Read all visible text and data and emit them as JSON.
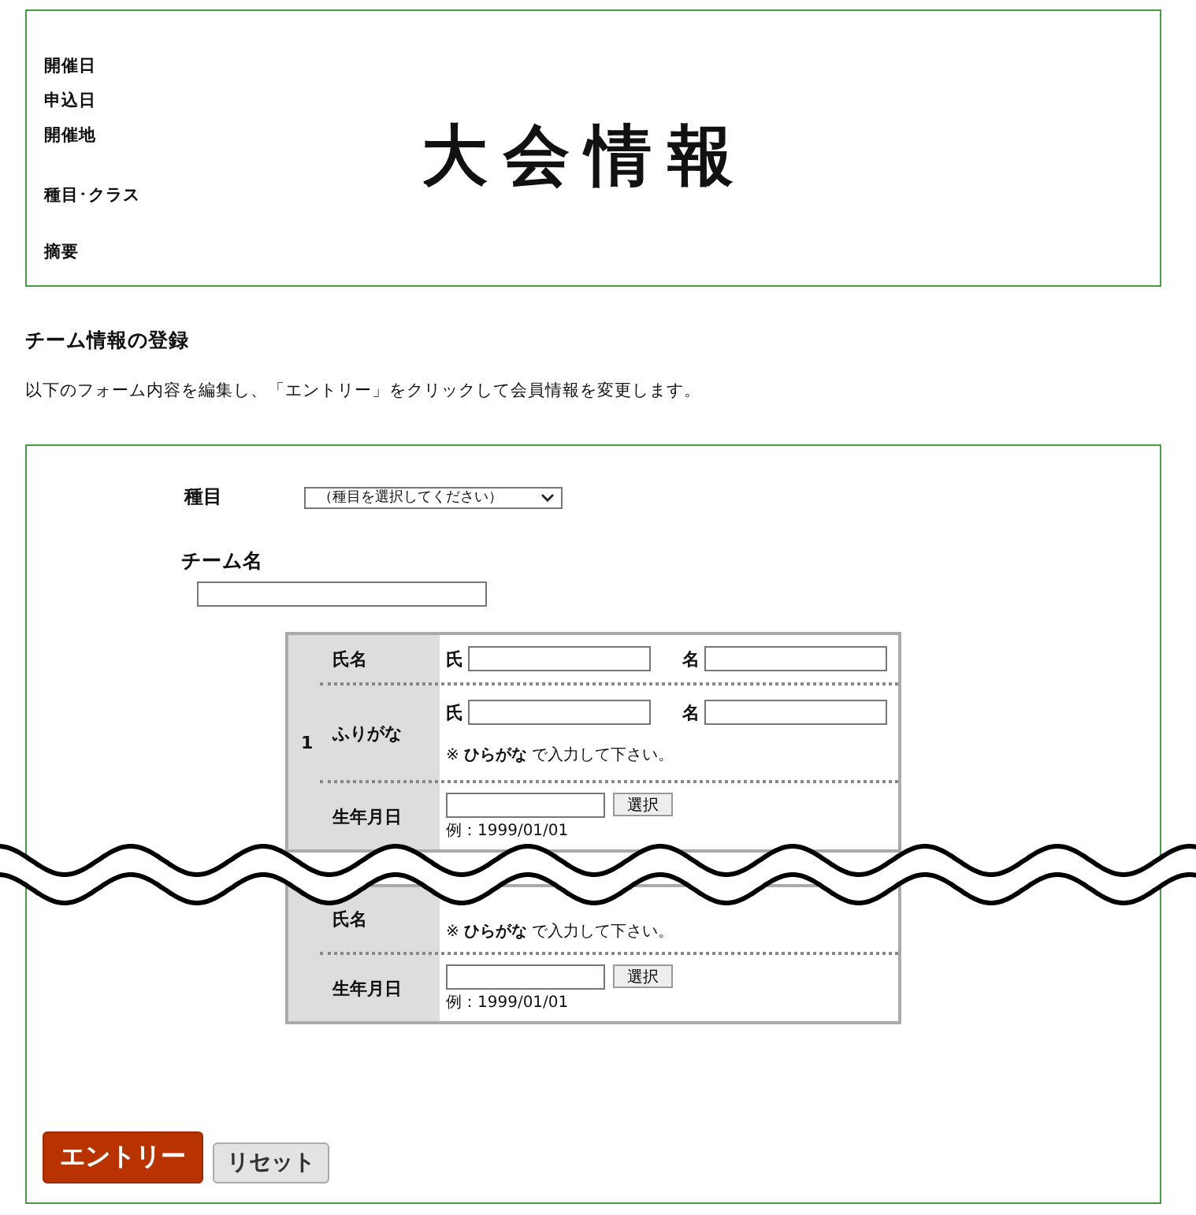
{
  "event_info": {
    "title": "大会情報",
    "fields": [
      {
        "label": "開催日"
      },
      {
        "label": "申込日"
      },
      {
        "label": "開催地"
      },
      {
        "label": "種目･クラス"
      },
      {
        "label": "摘要"
      }
    ]
  },
  "section": {
    "heading": "チーム情報の登録",
    "description": "以下のフォーム内容を編集し、「エントリー」をクリックして会員情報を変更します。"
  },
  "form": {
    "category": {
      "label": "種目",
      "value": "（種目を選択してください）"
    },
    "team_name": {
      "label": "チーム名"
    },
    "members": [
      {
        "number": "1",
        "rows": [
          {
            "kind": "name",
            "label": "氏名",
            "last_label": "氏",
            "first_label": "名"
          },
          {
            "kind": "kana",
            "label": "ふりがな",
            "last_label": "氏",
            "first_label": "名",
            "note": "※ **ひらがな** で入力して下さい。"
          },
          {
            "kind": "birth",
            "label": "生年月日",
            "button": "選択",
            "hint": "例：1999/01/01"
          }
        ]
      },
      {
        "rows": [
          {
            "kind": "partial",
            "label": "氏名",
            "note": "※ **ひらがな** で入力して下さい。"
          },
          {
            "kind": "birth",
            "label": "生年月日",
            "button": "選択",
            "hint": "例：1999/01/01"
          }
        ]
      }
    ],
    "buttons": [
      {
        "kind": "primary",
        "label": "エントリー"
      },
      {
        "kind": "secondary",
        "label": "リセット"
      }
    ]
  }
}
